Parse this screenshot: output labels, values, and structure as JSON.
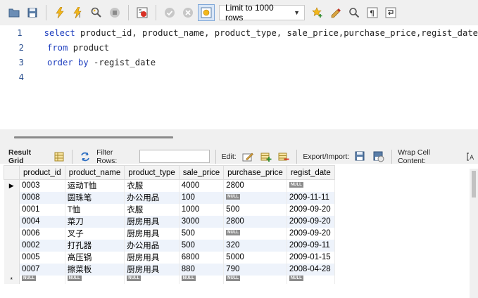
{
  "toolbar": {
    "limit_label": "Limit to 1000 rows"
  },
  "editor": {
    "lines": [
      {
        "num": "1",
        "kw": "select",
        "rest": " product_id, product_name, product_type, sale_price,purchase_price,regist_date"
      },
      {
        "num": "2",
        "kw": "from",
        "rest": " product"
      },
      {
        "num": "3",
        "kw": "order by",
        "rest": " -regist_date"
      },
      {
        "num": "4",
        "kw": "",
        "rest": ""
      }
    ]
  },
  "result_bar": {
    "tab_label": "Result Grid",
    "filter_label": "Filter Rows:",
    "filter_value": "",
    "edit_label": "Edit:",
    "export_label": "Export/Import:",
    "wrap_label": "Wrap Cell Content:"
  },
  "grid": {
    "null_text": "NULL",
    "columns": [
      "product_id",
      "product_name",
      "product_type",
      "sale_price",
      "purchase_price",
      "regist_date"
    ],
    "rows": [
      [
        "0003",
        "运动T恤",
        "衣服",
        "4000",
        "2800",
        null
      ],
      [
        "0008",
        "圆珠笔",
        "办公用品",
        "100",
        null,
        "2009-11-11"
      ],
      [
        "0001",
        "T恤",
        "衣服",
        "1000",
        "500",
        "2009-09-20"
      ],
      [
        "0004",
        "菜刀",
        "厨房用具",
        "3000",
        "2800",
        "2009-09-20"
      ],
      [
        "0006",
        "叉子",
        "厨房用具",
        "500",
        null,
        "2009-09-20"
      ],
      [
        "0002",
        "打孔器",
        "办公用品",
        "500",
        "320",
        "2009-09-11"
      ],
      [
        "0005",
        "高压锅",
        "厨房用具",
        "6800",
        "5000",
        "2009-01-15"
      ],
      [
        "0007",
        "擦菜板",
        "厨房用具",
        "880",
        "790",
        "2008-04-28"
      ]
    ],
    "current_row_marker": "▶",
    "new_row_marker": "*"
  }
}
